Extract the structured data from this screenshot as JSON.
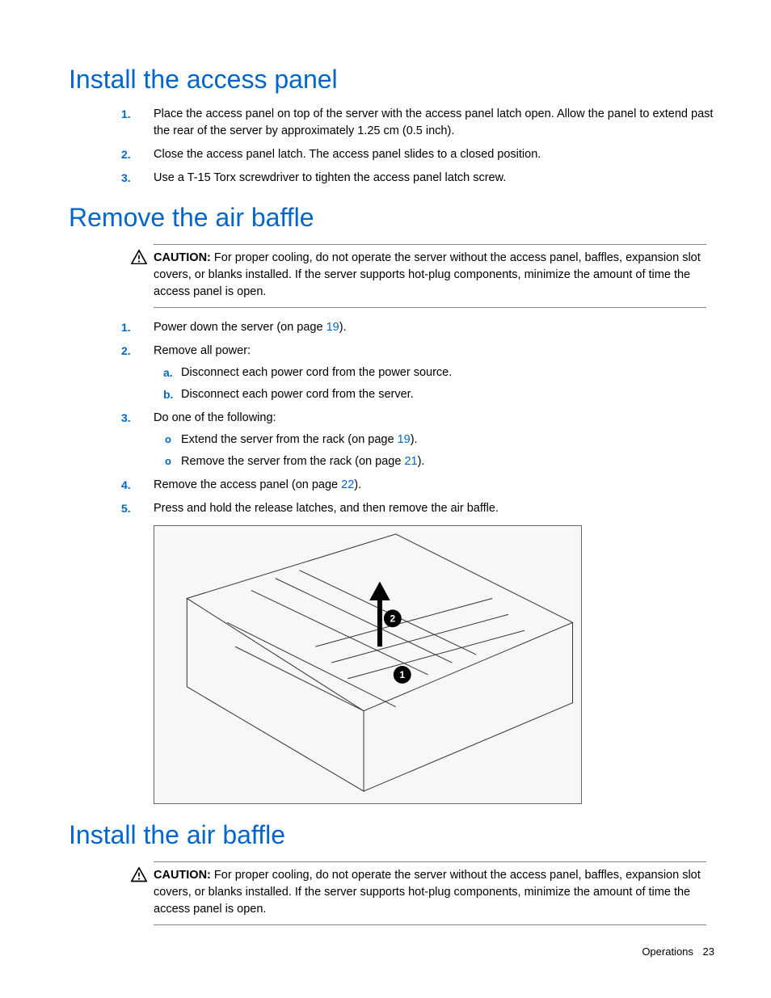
{
  "section1": {
    "title": "Install the access panel",
    "steps": [
      {
        "n": "1.",
        "text": "Place the access panel on top of the server with the access panel latch open. Allow the panel to extend past the rear of the server by approximately 1.25 cm (0.5 inch)."
      },
      {
        "n": "2.",
        "text": "Close the access panel latch. The access panel slides to a closed position."
      },
      {
        "n": "3.",
        "text": "Use a T-15 Torx screwdriver to tighten the access panel latch screw."
      }
    ]
  },
  "section2": {
    "title": "Remove the air baffle",
    "caution": {
      "label": "CAUTION:",
      "text": "For proper cooling, do not operate the server without the access panel, baffles, expansion slot covers, or blanks installed. If the server supports hot-plug components, minimize the amount of time the access panel is open."
    },
    "steps": {
      "s1": {
        "n": "1.",
        "pre": "Power down the server (on page ",
        "link": "19",
        "post": ")."
      },
      "s2": {
        "n": "2.",
        "text": "Remove all power:",
        "sub": [
          {
            "m": "a.",
            "text": "Disconnect each power cord from the power source."
          },
          {
            "m": "b.",
            "text": "Disconnect each power cord from the server."
          }
        ]
      },
      "s3": {
        "n": "3.",
        "text": "Do one of the following:",
        "sub": [
          {
            "m": "o",
            "pre": "Extend the server from the rack (on page ",
            "link": "19",
            "post": ")."
          },
          {
            "m": "o",
            "pre": "Remove the server from the rack (on page ",
            "link": "21",
            "post": ")."
          }
        ]
      },
      "s4": {
        "n": "4.",
        "pre": "Remove the access panel (on page ",
        "link": "22",
        "post": ")."
      },
      "s5": {
        "n": "5.",
        "text": "Press and hold the release latches, and then remove the air baffle."
      }
    },
    "figure": {
      "callouts": [
        "1",
        "2"
      ]
    }
  },
  "section3": {
    "title": "Install the air baffle",
    "caution": {
      "label": "CAUTION:",
      "text": "For proper cooling, do not operate the server without the access panel, baffles, expansion slot covers, or blanks installed. If the server supports hot-plug components, minimize the amount of time the access panel is open."
    }
  },
  "footer": {
    "label": "Operations",
    "page": "23"
  }
}
